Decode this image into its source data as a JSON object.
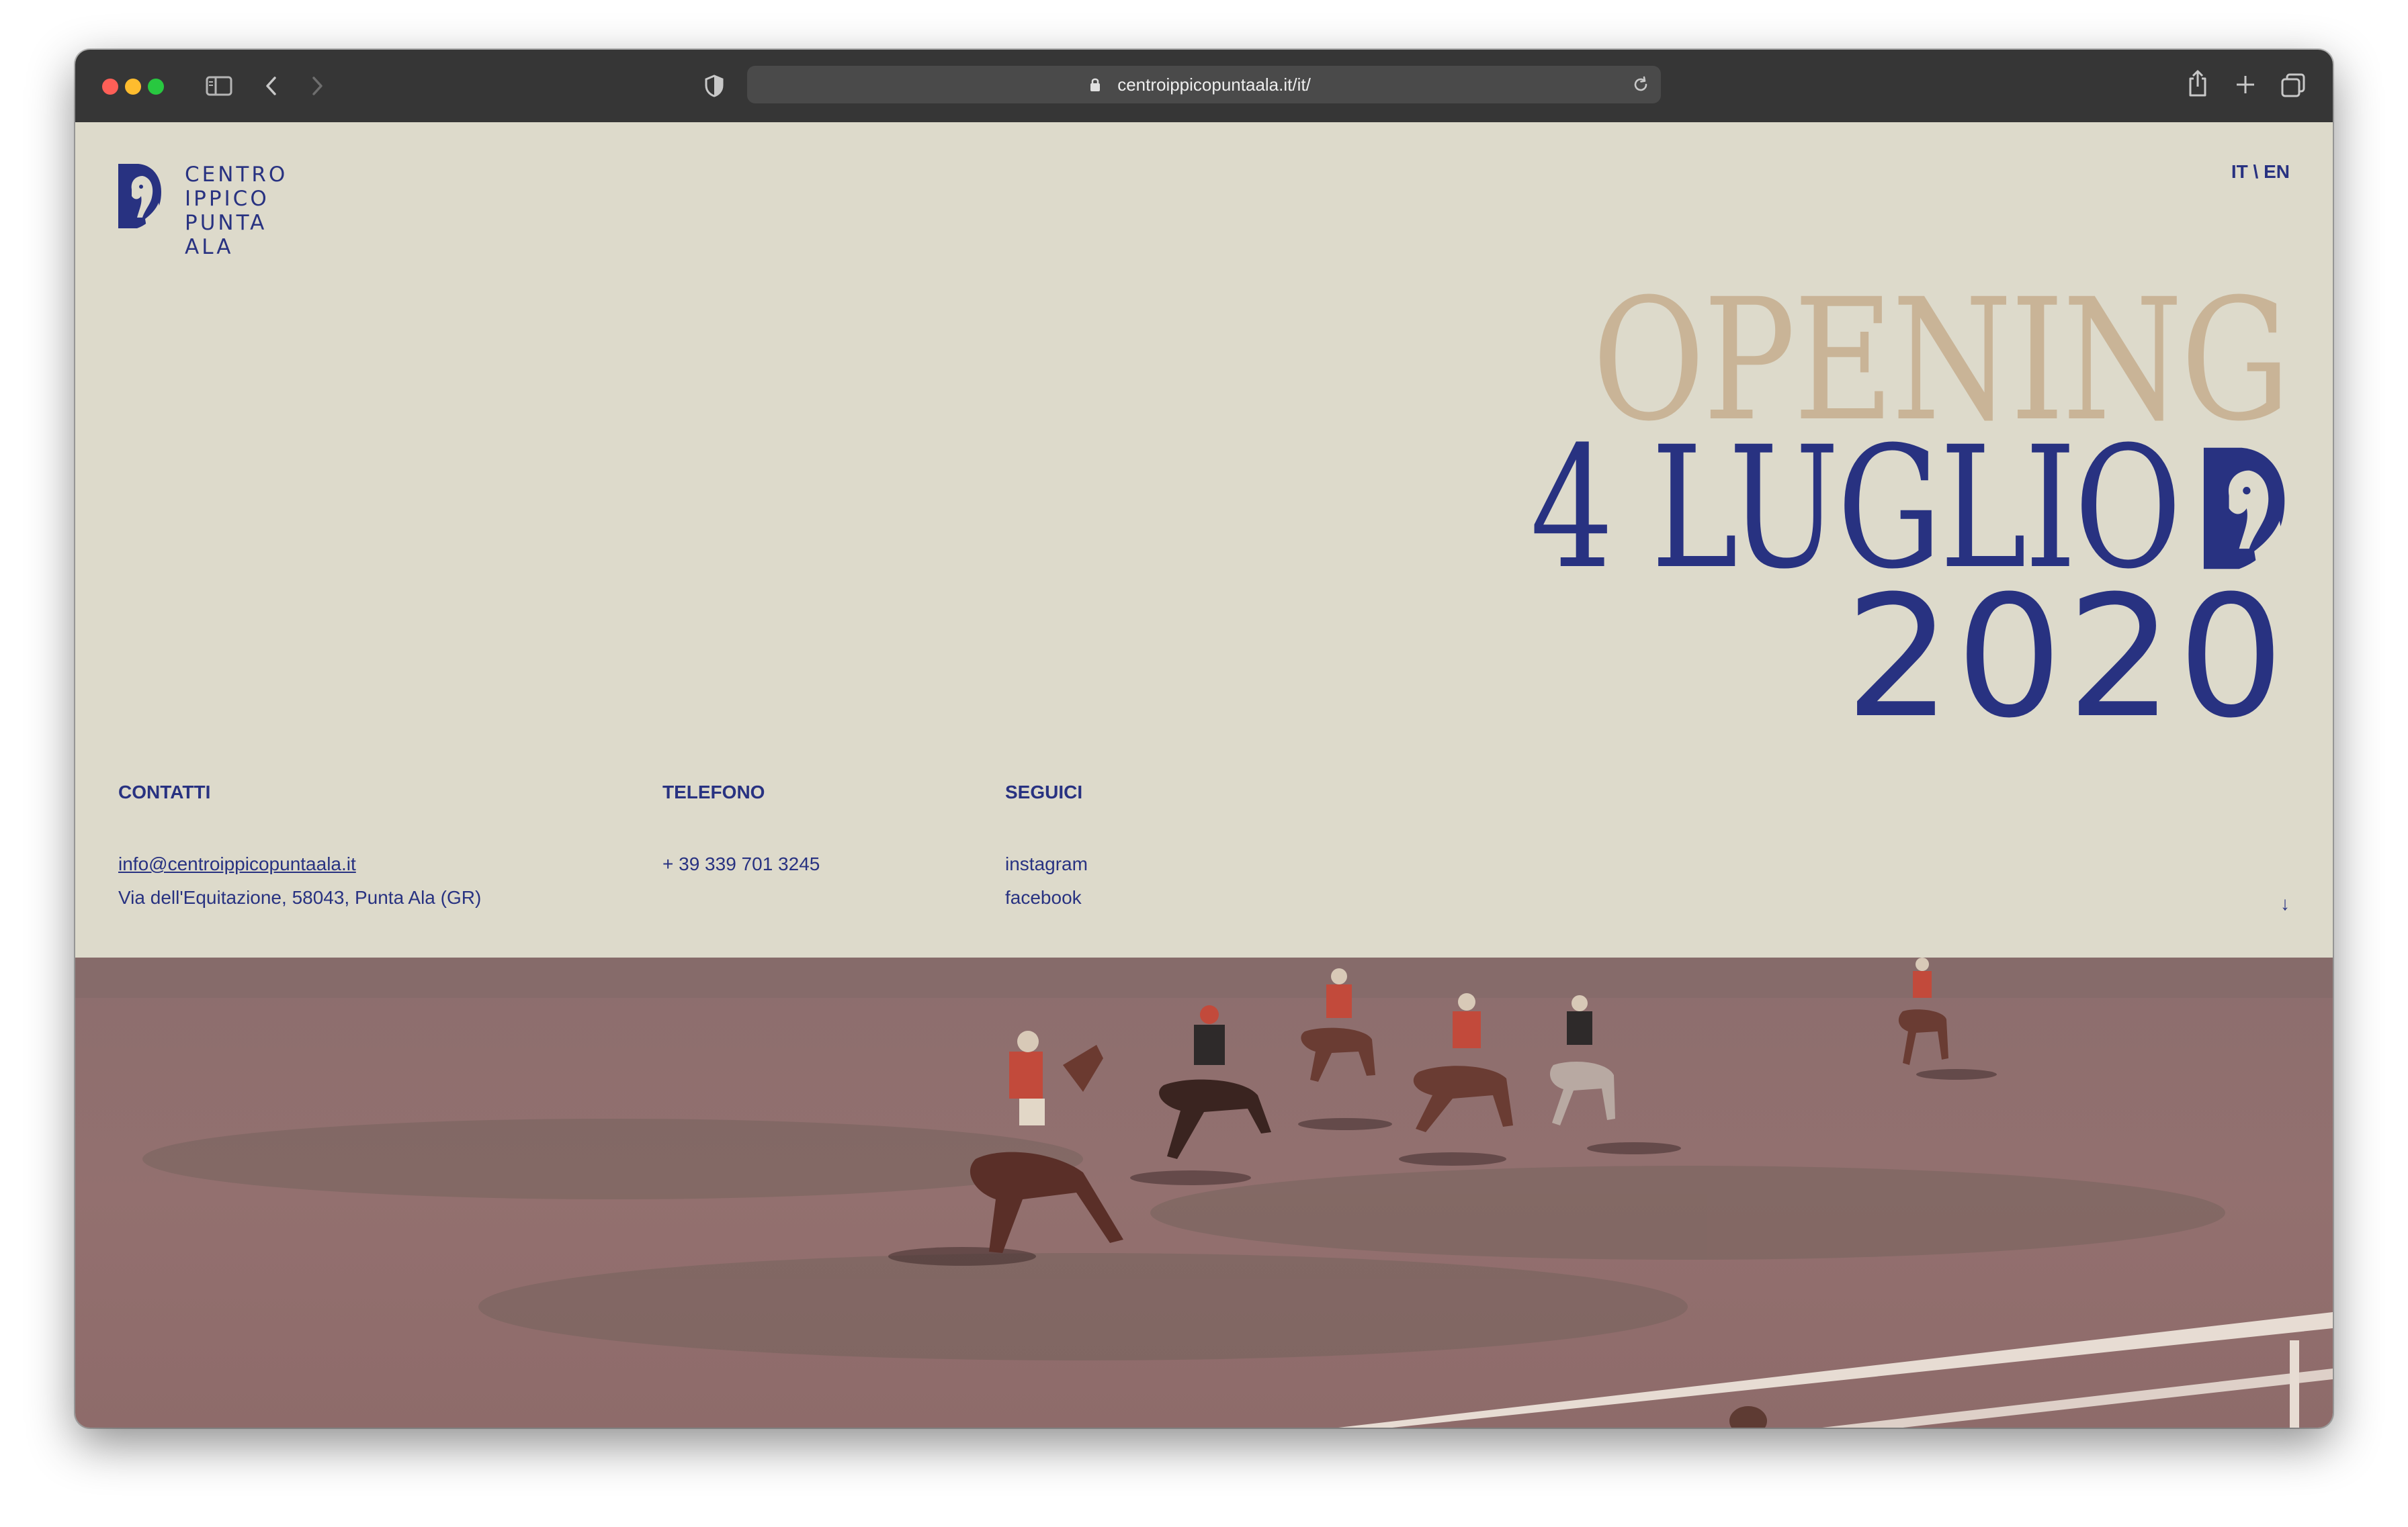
{
  "browser": {
    "url": "centroippicopuntaala.it/it/",
    "traffic_lights": {
      "close": "#ff5f57",
      "minimize": "#febc2e",
      "zoom": "#28c840"
    },
    "icons": [
      "sidebar-icon",
      "back-icon",
      "forward-icon",
      "shield-icon",
      "lock-icon",
      "reload-icon",
      "share-icon",
      "new-tab-icon",
      "tabs-overview-icon"
    ]
  },
  "header": {
    "logo_lines": [
      "CENTRO",
      "IPPICO",
      "PUNTA ALA"
    ],
    "language_switch": "IT \\ EN"
  },
  "hero": {
    "line1": "OPENING",
    "line2": "4 LUGLIO",
    "line3": "2020",
    "colors": {
      "opening": "#c9b497",
      "date": "#283281",
      "background": "#dddacb"
    }
  },
  "contacts": {
    "contatti": {
      "heading": "CONTATTI",
      "email": "info@centroippicopuntaala.it",
      "address": "Via dell'Equitazione, 58043, Punta Ala (GR)"
    },
    "telefono": {
      "heading": "TELEFONO",
      "phone": "+ 39 339 701 3245"
    },
    "seguici": {
      "heading": "SEGUICI",
      "instagram": "instagram",
      "facebook": "facebook"
    }
  },
  "scroll_indicator": "↓",
  "photo": {
    "subject": "polo-match-photo"
  }
}
